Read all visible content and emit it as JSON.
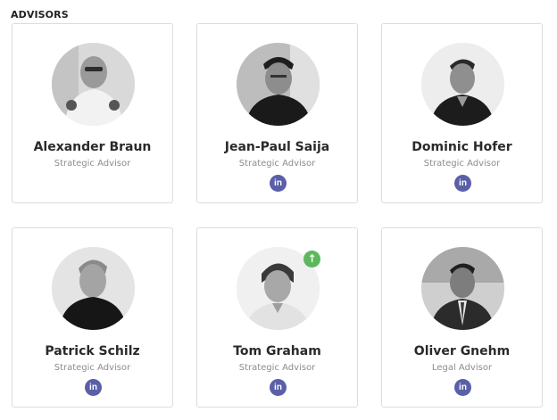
{
  "section": {
    "heading": "ADVISORS"
  },
  "advisors": [
    {
      "name": "Alexander Braun",
      "role": "Strategic Advisor",
      "has_linkedin": false,
      "avatar_icon": "person-photo-icon"
    },
    {
      "name": "Jean-Paul Saija",
      "role": "Strategic Advisor",
      "has_linkedin": true,
      "linkedin_label": "in",
      "avatar_icon": "person-photo-icon"
    },
    {
      "name": "Dominic Hofer",
      "role": "Strategic Advisor",
      "has_linkedin": true,
      "linkedin_label": "in",
      "avatar_icon": "person-photo-icon"
    },
    {
      "name": "Patrick Schilz",
      "role": "Strategic Advisor",
      "has_linkedin": true,
      "linkedin_label": "in",
      "avatar_icon": "person-photo-icon"
    },
    {
      "name": "Tom Graham",
      "role": "Strategic Advisor",
      "has_linkedin": true,
      "linkedin_label": "in",
      "badge": "↑",
      "avatar_icon": "person-photo-icon"
    },
    {
      "name": "Oliver Gnehm",
      "role": "Legal Advisor",
      "has_linkedin": true,
      "linkedin_label": "in",
      "avatar_icon": "person-photo-icon"
    }
  ],
  "colors": {
    "linkedin": "#5a5fa8",
    "badge": "#5cb85c",
    "name": "#2a2a2a",
    "role": "#8c8c8c",
    "card_border": "#dcdcdc"
  }
}
